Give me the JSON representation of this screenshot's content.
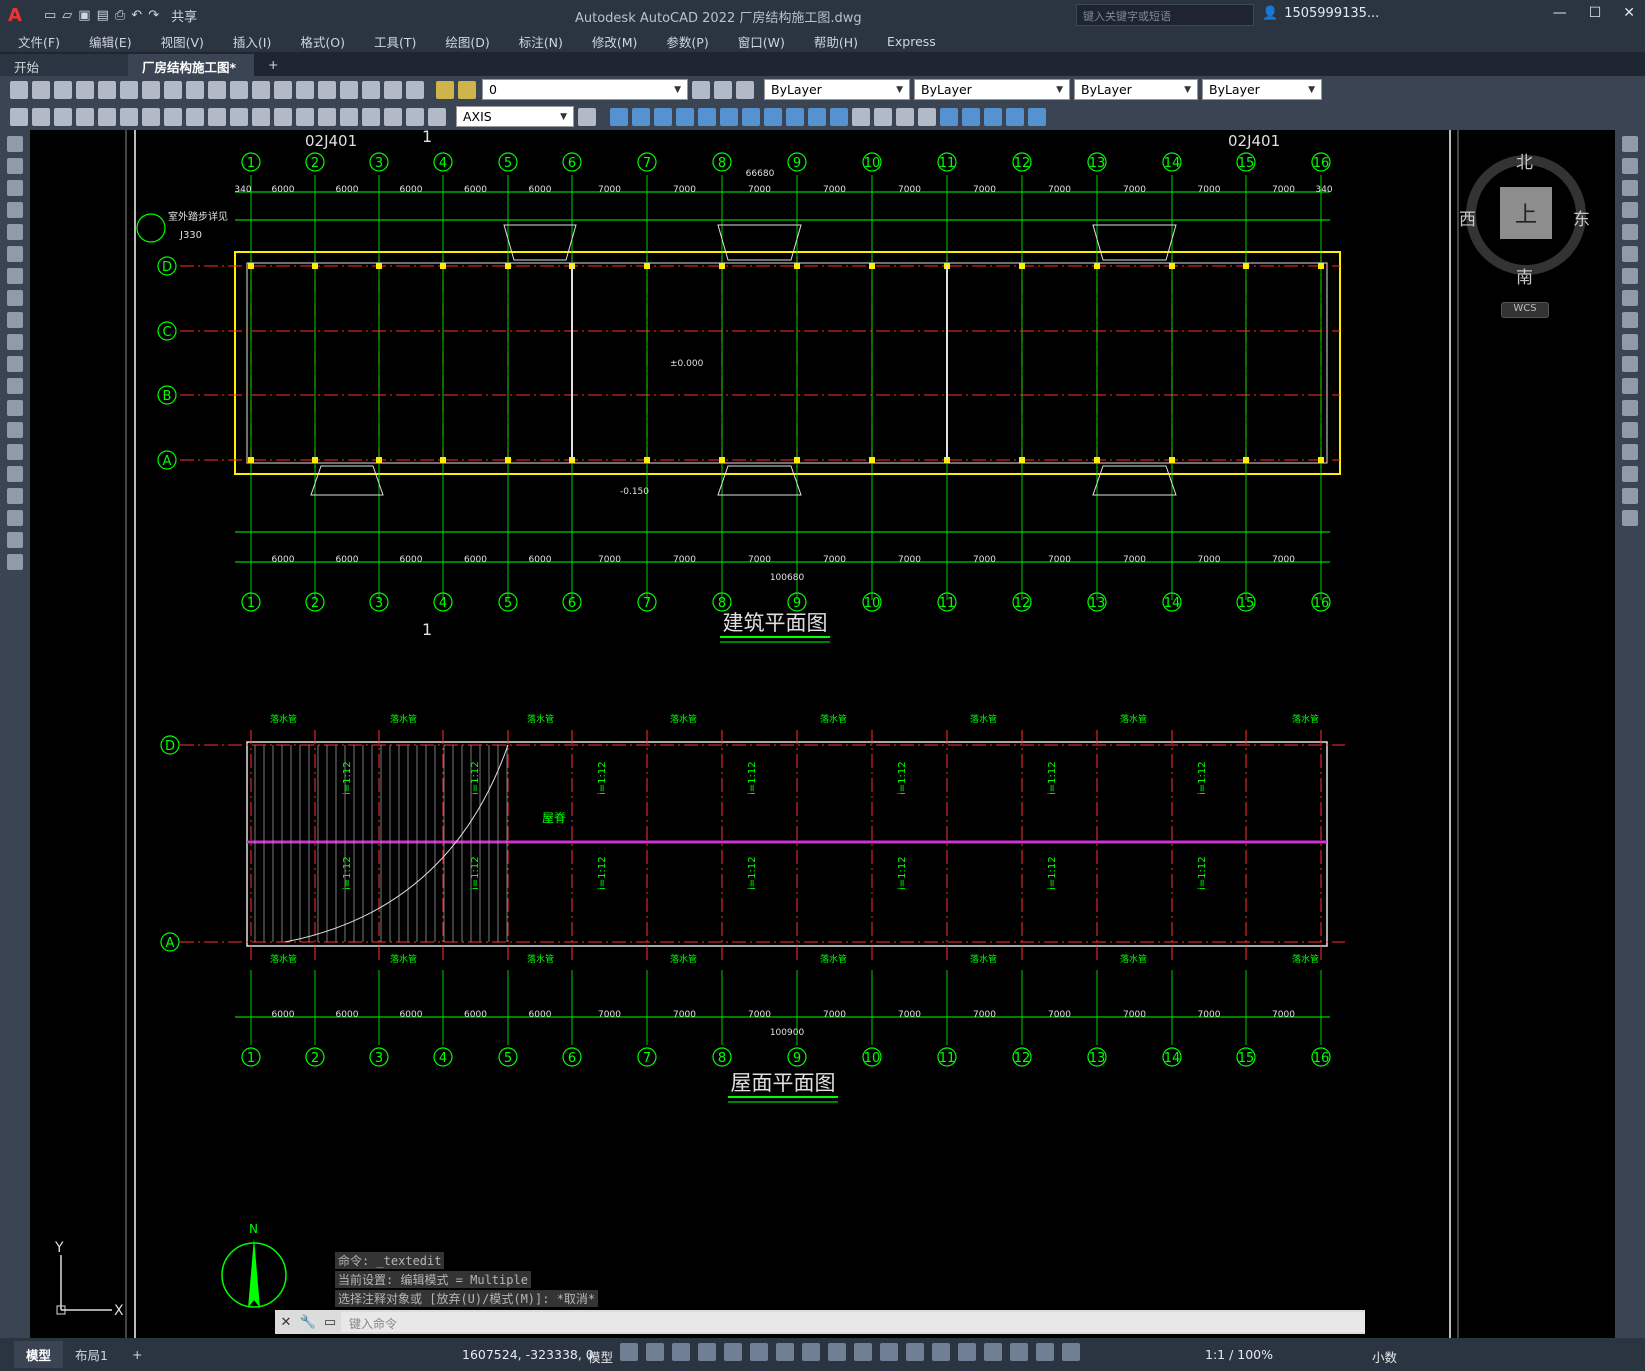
{
  "app": {
    "title": "Autodesk AutoCAD 2022    厂房结构施工图.dwg",
    "logo": "A",
    "share": "共享",
    "search_placeholder": "键入关键字或短语",
    "account": "1505999135...",
    "accent": "#2b3441"
  },
  "menu": [
    "文件(F)",
    "编辑(E)",
    "视图(V)",
    "插入(I)",
    "格式(O)",
    "工具(T)",
    "绘图(D)",
    "标注(N)",
    "修改(M)",
    "参数(P)",
    "窗口(W)",
    "帮助(H)",
    "Express"
  ],
  "tabs": {
    "start": "开始",
    "active": "厂房结构施工图*"
  },
  "toolbar": {
    "layer": "0",
    "color": "ByLayer",
    "linetype": "ByLayer",
    "lineweight": "ByLayer",
    "plotstyle": "ByLayer",
    "textstyle": "AXIS"
  },
  "drawing": {
    "plan_title": "建筑平面图",
    "roof_title": "屋面平面图",
    "axes_numbers": [
      "1",
      "2",
      "3",
      "4",
      "5",
      "6",
      "7",
      "8",
      "9",
      "10",
      "11",
      "12",
      "13",
      "14",
      "15",
      "16"
    ],
    "axes_letters_plan": [
      "D",
      "C",
      "B",
      "A"
    ],
    "axes_letters_roof": [
      "D",
      "A"
    ],
    "top_dims": [
      "340",
      "6000",
      "6000",
      "6000",
      "6000",
      "6000",
      "7000",
      "7000",
      "7000",
      "7000",
      "7000",
      "7000",
      "7000",
      "7000",
      "7000",
      "7000",
      "340"
    ],
    "total_top": "66680",
    "total_bottom": "100680",
    "total_roof": "100900",
    "ref1": "02J401",
    "ref2": "02J401",
    "section_label": "1",
    "detail_label": "室外踏步详见",
    "detail_ref": "J330",
    "elev_0": "±0.000",
    "elev_1": "-0.150",
    "roof_label": "屋脊",
    "drain_label": "落水管",
    "slope_label": "i=1:12",
    "north": "N"
  },
  "compass": {
    "n": "北",
    "s": "南",
    "e": "东",
    "w": "西",
    "face": "上",
    "wcs": "WCS"
  },
  "command": {
    "history": [
      "命令: _textedit",
      "当前设置: 编辑模式 = Multiple",
      "选择注释对象或 [放弃(U)/模式(M)]: *取消*"
    ],
    "placeholder": "键入命令"
  },
  "status": {
    "tab_model": "模型",
    "tab_layout": "布局1",
    "coords": "1607524, -323338, 0",
    "mode": "模型",
    "scale": "1:1 / 100%",
    "units": "小数"
  }
}
